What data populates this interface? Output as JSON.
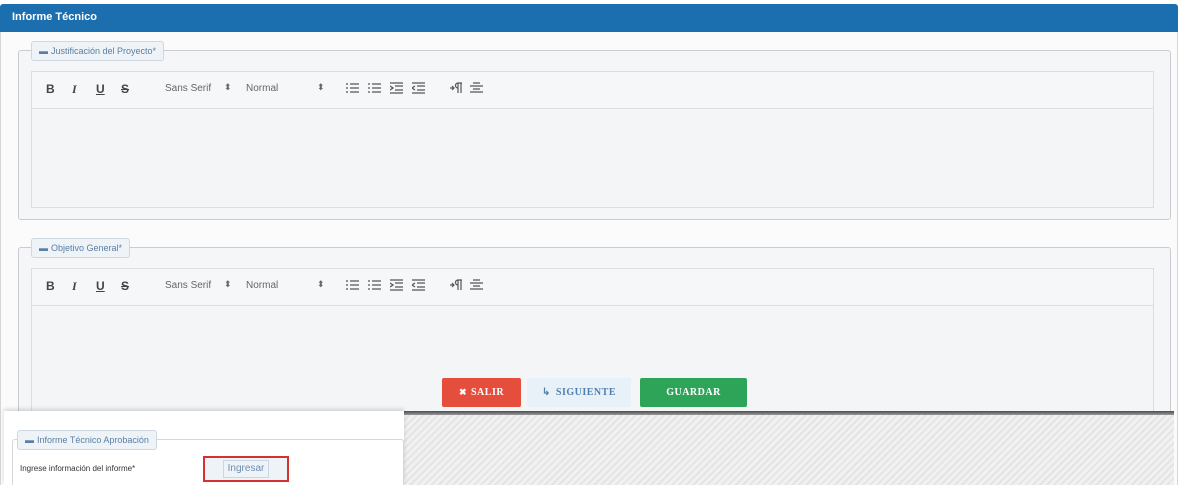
{
  "header": {
    "title": "Informe Técnico"
  },
  "sections": [
    {
      "legend": "Justificación del Proyecto*"
    },
    {
      "legend": "Objetivo General*"
    }
  ],
  "toolbar": {
    "bold": "B",
    "italic": "I",
    "underline": "U",
    "strike": "S",
    "font": "Sans Serif",
    "size": "Normal",
    "arrow": "⬍"
  },
  "actions": {
    "salir": "SALIR",
    "siguiente": "SIGUIENTE",
    "guardar": "GUARDAR"
  },
  "aprobacion": {
    "legend": "Informe Técnico Aprobación",
    "label": "Ingrese información del informe*",
    "button": "Ingresar"
  },
  "colors": {
    "header": "#1b6fae",
    "salir": "#e54d3d",
    "guardar": "#2ea459",
    "siguiente_text": "#4f81b0"
  }
}
